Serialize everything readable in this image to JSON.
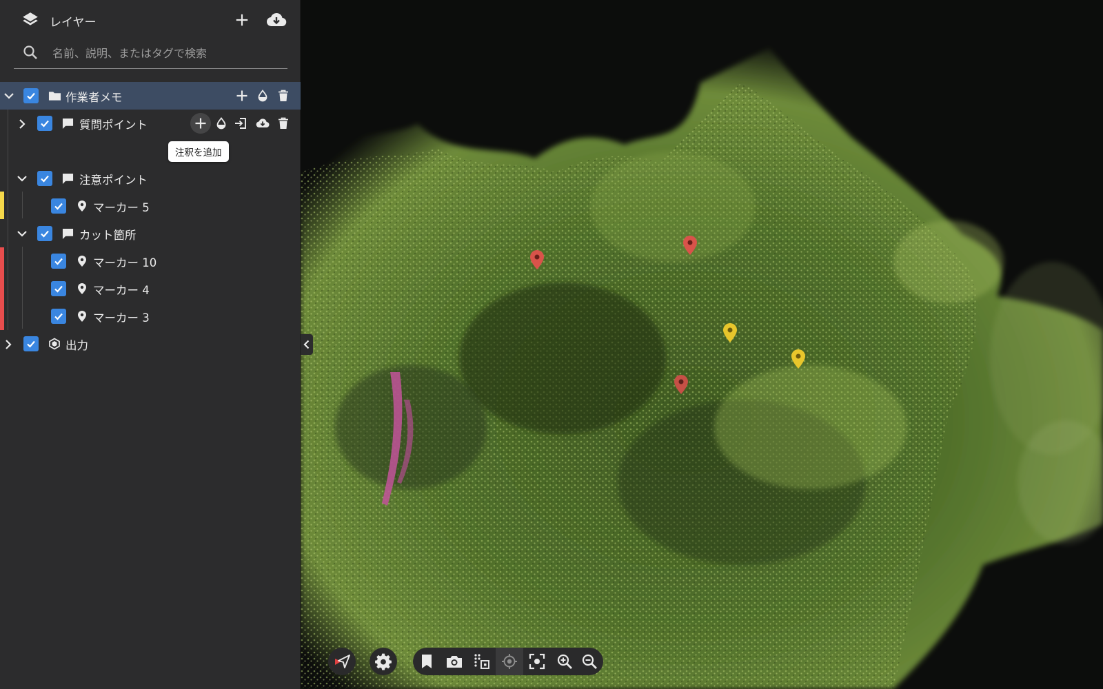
{
  "sidebar": {
    "title": "レイヤー",
    "search_placeholder": "名前、説明、またはタグで検索",
    "tooltip": "注釈を追加",
    "tree": {
      "root": {
        "label": "作業者メモ"
      },
      "question_points": {
        "label": "質問ポイント"
      },
      "caution_points": {
        "label": "注意ポイント",
        "color": "#f5d84a"
      },
      "marker_5": {
        "label": "マーカー 5"
      },
      "cut_points": {
        "label": "カット箇所",
        "color": "#e84d4d"
      },
      "marker_10": {
        "label": "マーカー 10"
      },
      "marker_4": {
        "label": "マーカー 4"
      },
      "marker_3": {
        "label": "マーカー 3"
      },
      "output": {
        "label": "出力"
      }
    }
  },
  "colors": {
    "accent": "#3a86e0",
    "selected_row": "#3d4c63",
    "marker_red": "#d9534a",
    "marker_yellow": "#e8c62c"
  },
  "icons": {
    "header": [
      "layers-icon",
      "plus-icon",
      "cloud-download-icon"
    ],
    "search": "search-icon",
    "tree": [
      "chevron-down-icon",
      "chevron-right-icon",
      "folder-icon",
      "comment-icon",
      "map-pin-icon",
      "cube-icon",
      "opacity-icon",
      "delete-icon",
      "import-icon"
    ],
    "toolbar": [
      "navigate-icon",
      "settings-icon",
      "bookmark-icon",
      "camera-icon",
      "measure-icon",
      "target-icon",
      "focus-icon",
      "zoom-in-icon",
      "zoom-out-icon"
    ]
  }
}
